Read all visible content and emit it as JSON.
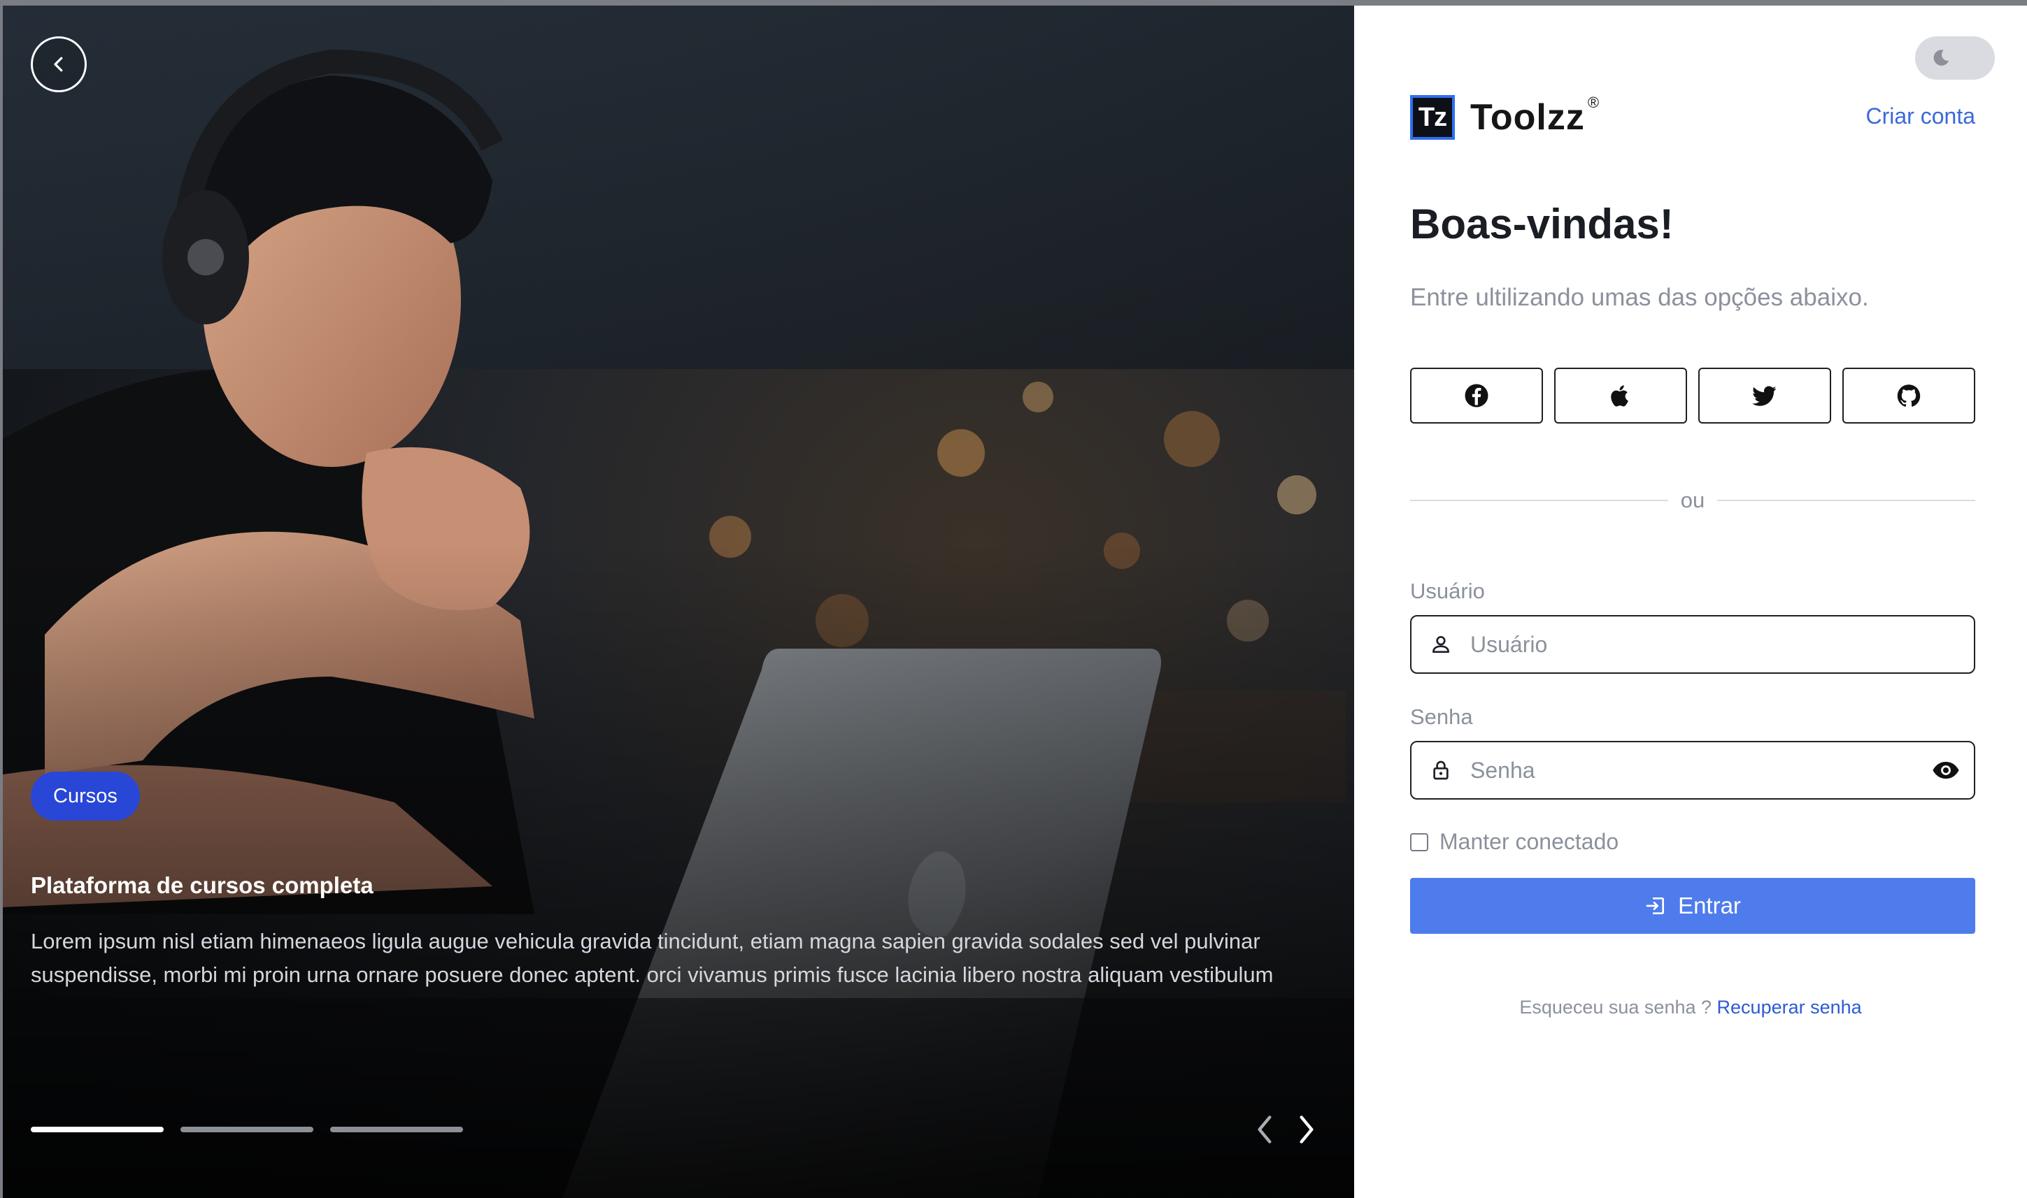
{
  "hero": {
    "badge": "Cursos",
    "title": "Plataforma de cursos completa",
    "description": "Lorem ipsum nisl etiam himenaeos ligula augue vehicula gravida tincidunt, etiam magna sapien gravida sodales sed vel pulvinar suspendisse, morbi mi proin urna ornare posuere donec aptent. orci vivamus primis fusce lacinia libero nostra aliquam vestibulum",
    "slides_total": 3,
    "active_slide": 1
  },
  "brand": {
    "name": "Toolzz",
    "mark": "Tz",
    "registered": "®"
  },
  "header": {
    "create_account": "Criar conta"
  },
  "login": {
    "title": "Boas-vindas!",
    "subtitle": "Entre ultilizando umas das opções abaixo.",
    "social_buttons": [
      {
        "name": "facebook",
        "icon": "facebook-icon"
      },
      {
        "name": "apple",
        "icon": "apple-icon"
      },
      {
        "name": "twitter",
        "icon": "twitter-icon"
      },
      {
        "name": "github",
        "icon": "github-icon"
      }
    ],
    "divider": "ou",
    "username": {
      "label": "Usuário",
      "placeholder": "Usuário",
      "value": ""
    },
    "password": {
      "label": "Senha",
      "placeholder": "Senha",
      "value": ""
    },
    "remember": {
      "label": "Manter conectado",
      "checked": false
    },
    "submit": "Entrar",
    "forgot_prefix": "Esqueceu sua senha ?",
    "forgot_link": "Recuperar senha"
  },
  "colors": {
    "badge": "#2847d6",
    "primary_button": "#4e7ced",
    "link": "#3b69d9",
    "brand_mark_border": "#2f6ff0"
  }
}
